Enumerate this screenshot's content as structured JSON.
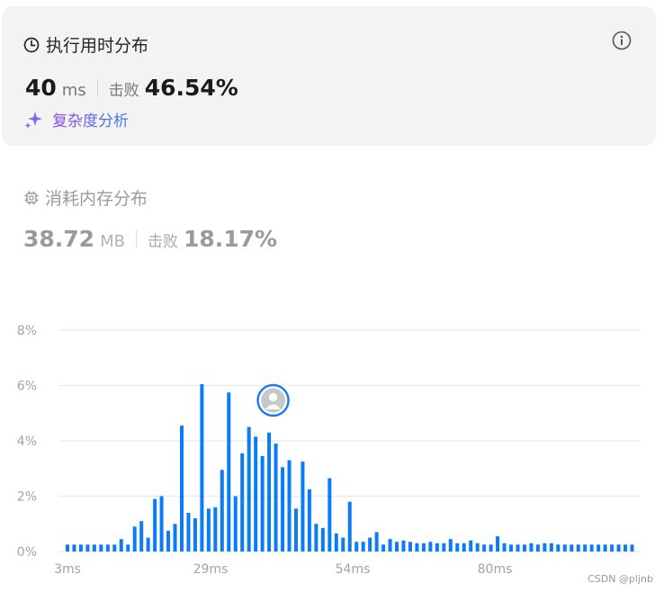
{
  "runtime": {
    "title": "执行用时分布",
    "value": "40",
    "unit": "ms",
    "beat_label": "击败",
    "beat_percent": "46.54%",
    "analysis_label": "复杂度分析",
    "clock_icon": "clock-icon",
    "info_icon": "info-icon",
    "sparkle_icon": "sparkle-icon"
  },
  "memory": {
    "title": "消耗内存分布",
    "value": "38.72",
    "unit": "MB",
    "beat_label": "击败",
    "beat_percent": "18.17%",
    "chip_icon": "chip-icon"
  },
  "chart_data": {
    "type": "bar",
    "title": "",
    "xlabel": "",
    "ylabel": "",
    "x_tick_labels": [
      "3ms",
      "29ms",
      "54ms",
      "80ms"
    ],
    "y_tick_labels": [
      "0%",
      "2%",
      "4%",
      "6%",
      "8%"
    ],
    "ylim": [
      0,
      8
    ],
    "grid": true,
    "bar_color": "#0a7cf6",
    "marker": {
      "index": 31,
      "label": "current submission",
      "icon": "avatar-icon"
    },
    "values": [
      0.25,
      0.25,
      0.25,
      0.25,
      0.25,
      0.25,
      0.25,
      0.25,
      0.45,
      0.25,
      0.9,
      1.1,
      0.5,
      1.9,
      2.0,
      0.75,
      1.0,
      4.55,
      1.4,
      1.2,
      6.05,
      1.55,
      1.6,
      2.95,
      5.75,
      2.0,
      3.55,
      4.5,
      4.15,
      3.45,
      4.3,
      3.9,
      3.05,
      3.3,
      1.55,
      3.25,
      2.25,
      1.0,
      0.85,
      2.65,
      0.65,
      0.5,
      1.8,
      0.35,
      0.35,
      0.5,
      0.7,
      0.25,
      0.45,
      0.35,
      0.4,
      0.35,
      0.3,
      0.3,
      0.35,
      0.3,
      0.3,
      0.45,
      0.3,
      0.3,
      0.4,
      0.3,
      0.25,
      0.25,
      0.55,
      0.3,
      0.25,
      0.25,
      0.25,
      0.3,
      0.25,
      0.3,
      0.3,
      0.25,
      0.25,
      0.25,
      0.25,
      0.25,
      0.25,
      0.25,
      0.25,
      0.25,
      0.25,
      0.25,
      0.25
    ]
  },
  "watermark": "CSDN @pljnb"
}
